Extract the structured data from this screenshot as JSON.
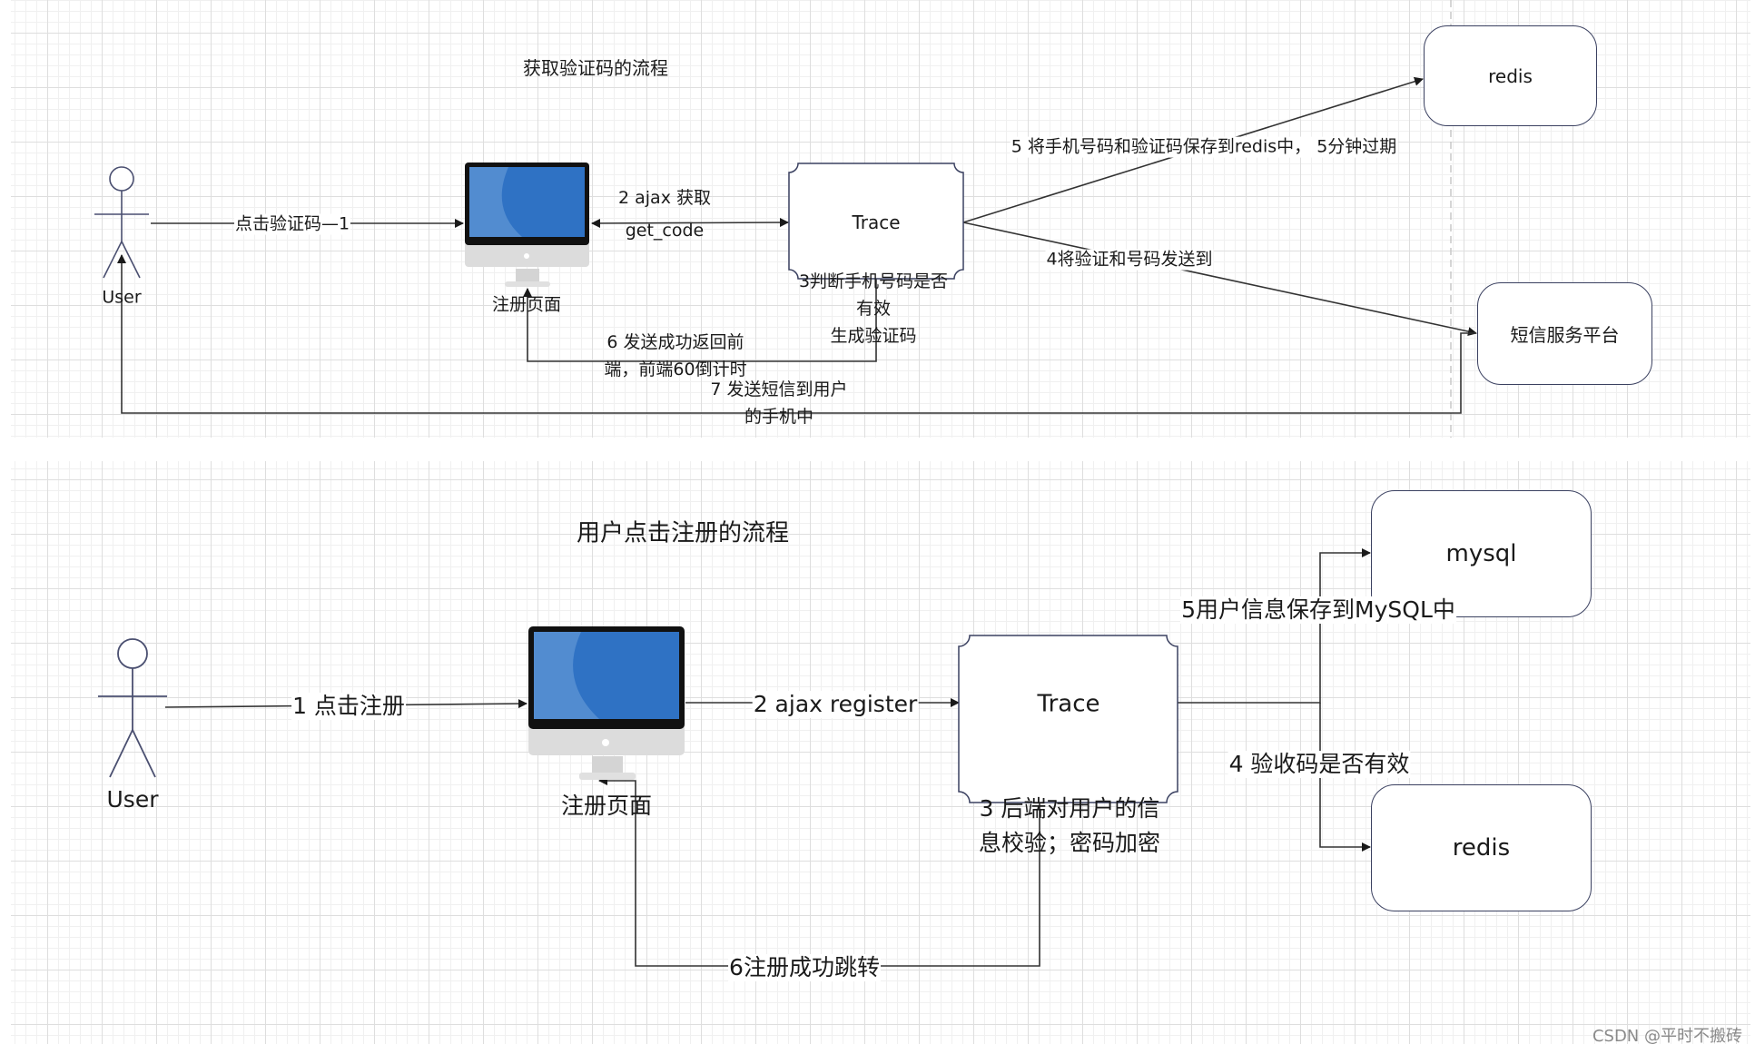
{
  "diagram_top": {
    "title": "获取验证码的流程",
    "actor_label": "User",
    "monitor_label": "注册页面",
    "trace_label": "Trace",
    "redis_label": "redis",
    "sms_label": "短信服务平台",
    "edges": {
      "step1": "点击验证码—1",
      "step2_line1": "2 ajax 获取",
      "step2_line2": "get_code",
      "step3_line1": "3判断手机号码是否",
      "step3_line2": "有效",
      "step3_line3": "生成验证码",
      "step4": "4将验证和号码发送到",
      "step5": "5 将手机号码和验证码保存到redis中， 5分钟过期",
      "step6_line1": "6 发送成功返回前",
      "step6_line2": "端，前端60倒计时",
      "step7_line1": "7 发送短信到用户",
      "step7_line2": "的手机中"
    }
  },
  "diagram_bottom": {
    "title": "用户点击注册的流程",
    "actor_label": "User",
    "monitor_label": "注册页面",
    "trace_label": "Trace",
    "mysql_label": "mysql",
    "redis_label": "redis",
    "edges": {
      "step1": "1 点击注册",
      "step2": "2 ajax register",
      "step3_line1": "3 后端对用户的信",
      "step3_line2": "息校验；密码加密",
      "step4": "4 验收码是否有效",
      "step5": "5用户信息保存到MySQL中",
      "step6": "6注册成功跳转"
    }
  },
  "watermark": "CSDN @平时不搬砖",
  "colors": {
    "line": "#333333",
    "shape_border": "#3a4060",
    "actor": "#4a4f70",
    "screen": "#2f72c4"
  }
}
